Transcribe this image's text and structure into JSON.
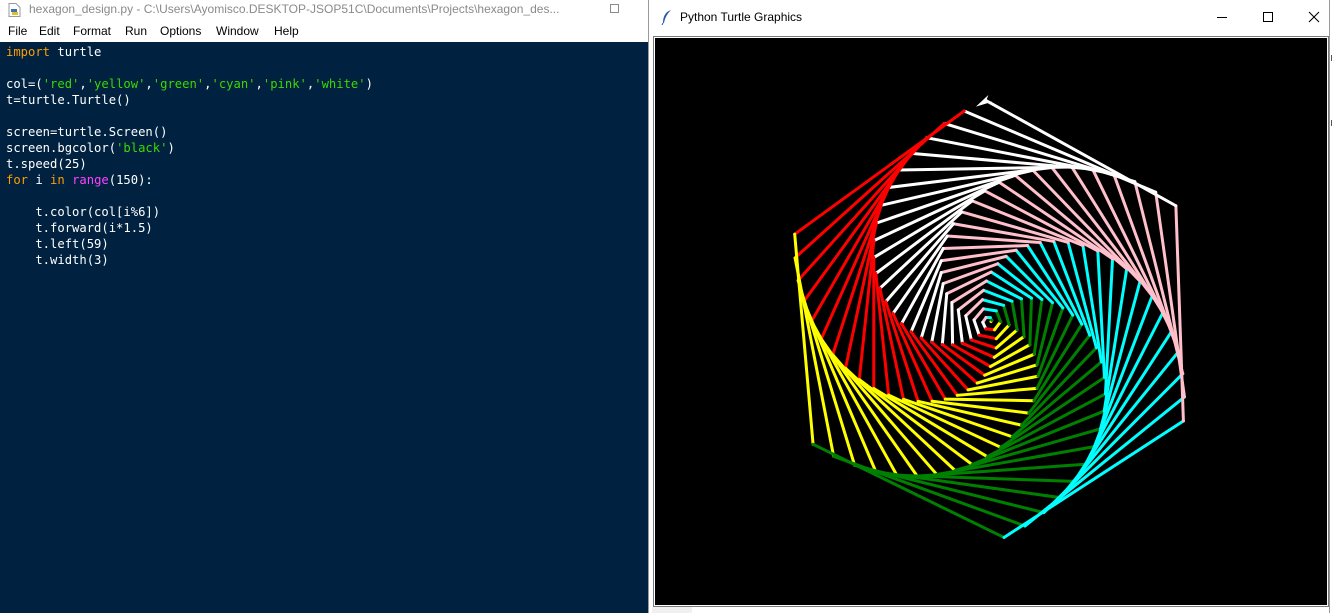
{
  "editor": {
    "title": "hexagon_design.py - C:\\Users\\Ayomisco.DESKTOP-JSOP51C\\Documents\\Projects\\hexagon_des...",
    "menu": [
      "File",
      "Edit",
      "Format",
      "Run",
      "Options",
      "Window",
      "Help"
    ],
    "code": {
      "l1_kw": "import",
      "l1_rest": " turtle",
      "l3_a": "col=(",
      "l3_s1": "'red'",
      "l3_s2": "'yellow'",
      "l3_s3": "'green'",
      "l3_s4": "'cyan'",
      "l3_s5": "'pink'",
      "l3_s6": "'white'",
      "l3_z": ")",
      "comma": ",",
      "l4": "t=turtle.Turtle()",
      "l6": "screen=turtle.Screen()",
      "l7_a": "screen.bgcolor(",
      "l7_s": "'black'",
      "l7_z": ")",
      "l8": "t.speed(25)",
      "l9_for": "for",
      "l9_i": " i ",
      "l9_in": "in",
      "l9_sp": " ",
      "l9_range": "range",
      "l9_z": "(150):",
      "l11": "    t.color(col[i%6])",
      "l12": "    t.forward(i*1.5)",
      "l13": "    t.left(59)",
      "l14": "    t.width(3)"
    }
  },
  "turtle_window": {
    "title": "Python Turtle Graphics"
  },
  "drawing": {
    "background": "#000000",
    "pen_colors": [
      "red",
      "yellow",
      "green",
      "cyan",
      "pink",
      "white"
    ],
    "turn_degrees": 59,
    "step_factor": 1.5,
    "iterations": 150,
    "pen_width": 3
  },
  "theme": {
    "code_bg": "#002240",
    "keyword": "#ff9d00",
    "string": "#3ad900",
    "builtin": "#ff41ff"
  }
}
